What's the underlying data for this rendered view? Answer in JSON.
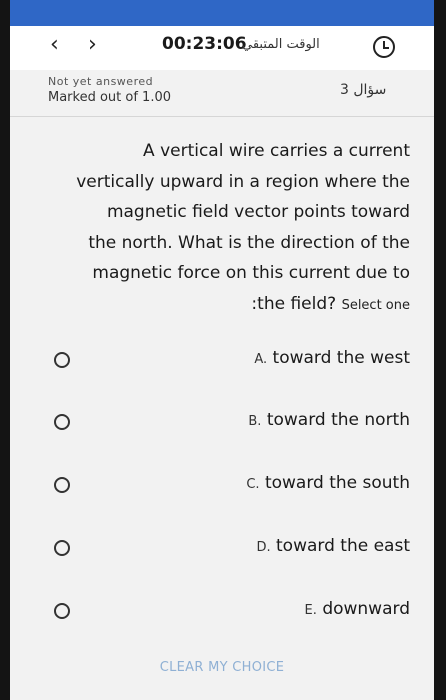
{
  "header": {
    "timer": "00:23:06",
    "timer_label": "الوقت المتبقي"
  },
  "question_meta": {
    "status": "Not yet answered",
    "marked": "Marked out of 1.00",
    "number": "سؤال 3"
  },
  "question": {
    "lines": [
      "A vertical wire carries a current",
      "vertically upward in a region where the",
      "magnetic field vector points toward",
      "the north. What is the direction of the",
      "magnetic force on this current due to",
      ":the field?"
    ],
    "select_hint": "Select one"
  },
  "options": [
    {
      "letter": "A.",
      "text": "toward the west"
    },
    {
      "letter": "B.",
      "text": "toward the north"
    },
    {
      "letter": "C.",
      "text": "toward the south"
    },
    {
      "letter": "D.",
      "text": "toward the east"
    },
    {
      "letter": "E.",
      "text": "downward"
    }
  ],
  "clear_label": "CLEAR MY CHOICE"
}
